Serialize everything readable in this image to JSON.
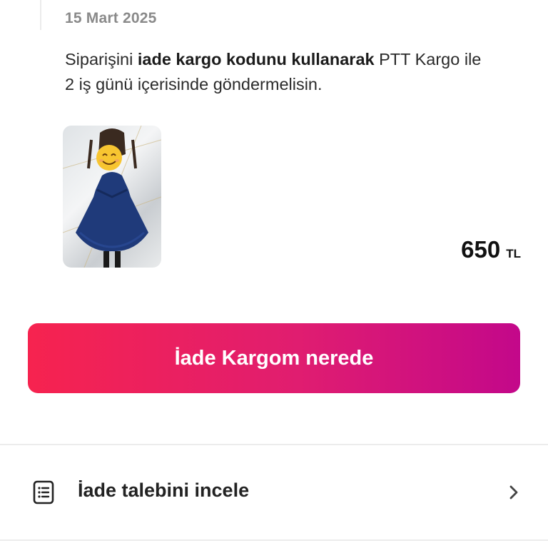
{
  "timeline": {
    "date": "15 Mart 2025",
    "message": {
      "part1": "Siparişini ",
      "bold": "iade kargo kodunu kullanarak",
      "part2": " PTT Kargo ile 2 iş günü içerisinde göndermelisin."
    }
  },
  "product": {
    "image_icon": "blue-dress-photo",
    "face_sticker": "smiling-face-emoji",
    "price": "650",
    "currency": "TL"
  },
  "cta": {
    "label": "İade Kargom nerede"
  },
  "review_row": {
    "icon": "document-list-icon",
    "label": "İade talebini incele",
    "chevron": "chevron-right-icon"
  },
  "colors": {
    "cta_start": "#f6234f",
    "cta_end": "#c3088a",
    "muted_text": "#8a8a8a"
  }
}
